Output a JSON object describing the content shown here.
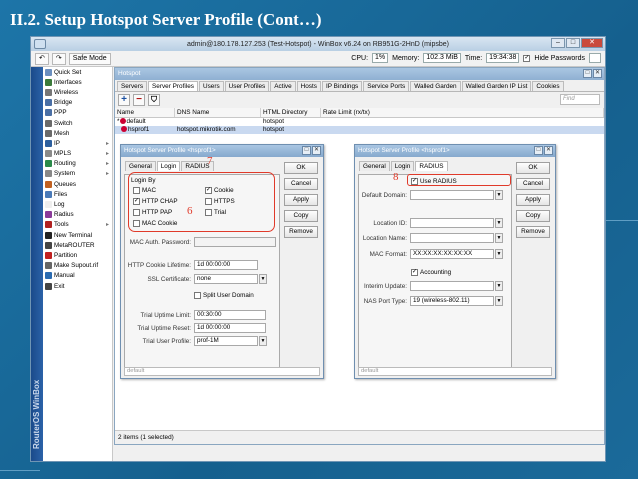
{
  "slide": {
    "title": "II.2. Setup Hotspot Server Profile (Cont…)"
  },
  "window": {
    "title": "admin@180.178.127.253 (Test-Hotspot) - WinBox v6.24 on RB951G-2HnD (mipsbe)",
    "brand_vertical": "RouterOS WinBox"
  },
  "toolbar": {
    "undo": "↶",
    "redo": "↷",
    "safe_mode": "Safe Mode",
    "cpu_label": "CPU:",
    "cpu": "1%",
    "memory_label": "Memory:",
    "memory": "102.3 MiB",
    "time_label": "Time:",
    "time": "19:34:38",
    "hide_passwords": "Hide Passwords"
  },
  "sidebar": {
    "items": [
      {
        "label": "Quick Set",
        "color": "#6b8fbf",
        "arrow": false
      },
      {
        "label": "Interfaces",
        "color": "#3a7a3a",
        "arrow": false
      },
      {
        "label": "Wireless",
        "color": "#777777",
        "arrow": false
      },
      {
        "label": "Bridge",
        "color": "#4a6fa5",
        "arrow": false
      },
      {
        "label": "PPP",
        "color": "#4a6fa5",
        "arrow": false
      },
      {
        "label": "Switch",
        "color": "#6a6a6a",
        "arrow": false
      },
      {
        "label": "Mesh",
        "color": "#6a6a6a",
        "arrow": false
      },
      {
        "label": "IP",
        "color": "#2d5f9e",
        "arrow": true
      },
      {
        "label": "MPLS",
        "color": "#8a8a8a",
        "arrow": true
      },
      {
        "label": "Routing",
        "color": "#2a8a4a",
        "arrow": true
      },
      {
        "label": "System",
        "color": "#888888",
        "arrow": true
      },
      {
        "label": "Queues",
        "color": "#c06020",
        "arrow": false
      },
      {
        "label": "Files",
        "color": "#4a7ab8",
        "arrow": false
      },
      {
        "label": "Log",
        "color": "#eeeeee",
        "arrow": false
      },
      {
        "label": "Radius",
        "color": "#8a3a9a",
        "arrow": false
      },
      {
        "label": "Tools",
        "color": "#b02020",
        "arrow": true
      },
      {
        "label": "New Terminal",
        "color": "#222222",
        "arrow": false
      },
      {
        "label": "MetaROUTER",
        "color": "#444444",
        "arrow": false
      },
      {
        "label": "Partition",
        "color": "#c02020",
        "arrow": false
      },
      {
        "label": "Make Supout.rif",
        "color": "#666666",
        "arrow": false
      },
      {
        "label": "Manual",
        "color": "#2a6ab0",
        "arrow": false
      },
      {
        "label": "Exit",
        "color": "#444444",
        "arrow": false
      }
    ]
  },
  "hotspot": {
    "title": "Hotspot",
    "tabs": [
      "Servers",
      "Server Profiles",
      "Users",
      "User Profiles",
      "Active",
      "Hosts",
      "IP Bindings",
      "Service Ports",
      "Walled Garden",
      "Walled Garden IP List",
      "Cookies"
    ],
    "find_placeholder": "Find",
    "columns": [
      "Name",
      "DNS Name",
      "HTML Directory",
      "Rate Limit (rx/tx)"
    ],
    "rows": [
      {
        "mark": "*",
        "name": "default",
        "dns": "",
        "html": "hotspot",
        "rate": ""
      },
      {
        "mark": "",
        "name": "hsprof1",
        "dns": "hotspot.mikrotik.com",
        "html": "hotspot",
        "rate": ""
      }
    ],
    "status": "2 items (1 selected)"
  },
  "dialog_left": {
    "title": "Hotspot Server Profile <hsprof1>",
    "tabs": [
      "General",
      "Login",
      "RADIUS"
    ],
    "login_by_label": "Login By",
    "login_options": [
      {
        "label": "MAC",
        "checked": false
      },
      {
        "label": "Cookie",
        "checked": true
      },
      {
        "label": "HTTP CHAP",
        "checked": true
      },
      {
        "label": "HTTPS",
        "checked": false
      },
      {
        "label": "HTTP PAP",
        "checked": false
      },
      {
        "label": "Trial",
        "checked": false
      },
      {
        "label": "MAC Cookie",
        "checked": false
      }
    ],
    "mac_auth_password_label": "MAC Auth. Password:",
    "http_cookie_lifetime_label": "HTTP Cookie Lifetime:",
    "http_cookie_lifetime": "1d 00:00:00",
    "ssl_certificate_label": "SSL Certificate:",
    "ssl_certificate": "none",
    "split_user_domain": "Split User Domain",
    "trial_uptime_limit_label": "Trial Uptime Limit:",
    "trial_uptime_limit": "00:30:00",
    "trial_uptime_reset_label": "Trial Uptime Reset:",
    "trial_uptime_reset": "1d 00:00:00",
    "trial_user_profile_label": "Trial User Profile:",
    "trial_user_profile": "prof-1M",
    "buttons": [
      "OK",
      "Cancel",
      "Apply",
      "Copy",
      "Remove"
    ],
    "status": "default",
    "annotations": {
      "tab": "7",
      "login_by": "6"
    }
  },
  "dialog_right": {
    "title": "Hotspot Server Profile <hsprof1>",
    "tabs": [
      "General",
      "Login",
      "RADIUS"
    ],
    "use_radius": "Use RADIUS",
    "default_domain_label": "Default Domain:",
    "location_id_label": "Location ID:",
    "location_name_label": "Location Name:",
    "mac_format_label": "MAC Format:",
    "mac_format": "XX:XX:XX:XX:XX:XX",
    "accounting": "Accounting",
    "interim_update_label": "Interim Update:",
    "nas_port_type_label": "NAS Port Type:",
    "nas_port_type": "19 (wireless-802.11)",
    "buttons": [
      "OK",
      "Cancel",
      "Apply",
      "Copy",
      "Remove"
    ],
    "status": "default",
    "annotations": {
      "use_radius": "8"
    }
  },
  "colors": {
    "annotation_red": "#e03a2a",
    "slide_bg": "#1b6a9a"
  }
}
